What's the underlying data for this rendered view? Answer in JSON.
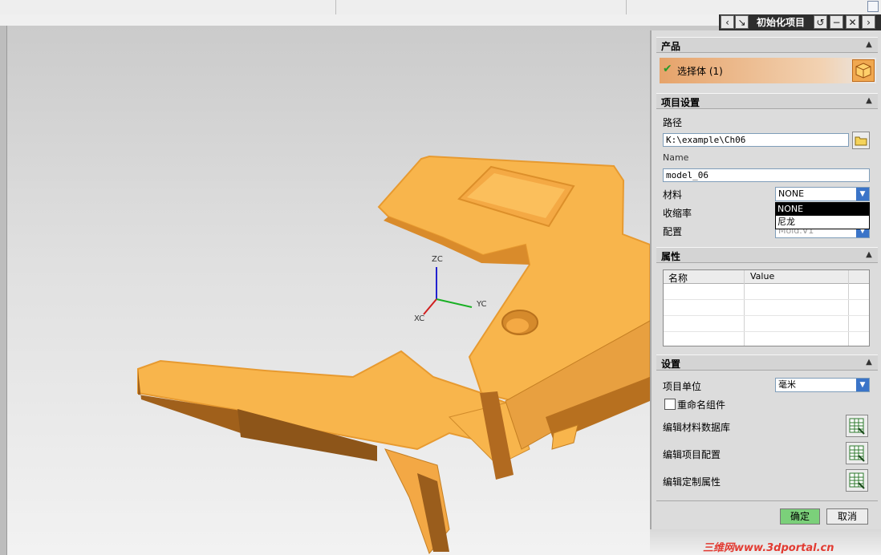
{
  "dialog": {
    "title": "初始化项目",
    "sections": {
      "product": "产品",
      "project_settings": "项目设置",
      "attributes": "属性",
      "settings": "设置"
    },
    "select_body": {
      "label": "选择体 (1)"
    },
    "path": {
      "label": "路径",
      "value": "K:\\example\\Ch06"
    },
    "name": {
      "label": "Name",
      "value": "model_06"
    },
    "material": {
      "label": "材料",
      "value": "NONE",
      "options": [
        "NONE",
        "尼龙"
      ]
    },
    "shrinkage": {
      "label": "收缩率"
    },
    "config": {
      "label": "配置",
      "value": "Mold.V1"
    },
    "attributes_table": {
      "columns": [
        "名称",
        "Value"
      ]
    },
    "unit": {
      "label": "项目单位",
      "value": "毫米"
    },
    "rename_components": {
      "label": "重命名组件",
      "checked": false
    },
    "edit_material_db": "编辑材料数据库",
    "edit_project_config": "编辑项目配置",
    "edit_custom_attributes": "编辑定制属性",
    "ok": "确定",
    "cancel": "取消"
  },
  "axes": {
    "x": "XC",
    "y": "YC",
    "z": "ZC"
  },
  "watermark": "三维网www.3dportal.cn",
  "colors": {
    "accent": "#3a74c8",
    "part": "#f6b24c",
    "ok_button": "#7bd07a"
  }
}
